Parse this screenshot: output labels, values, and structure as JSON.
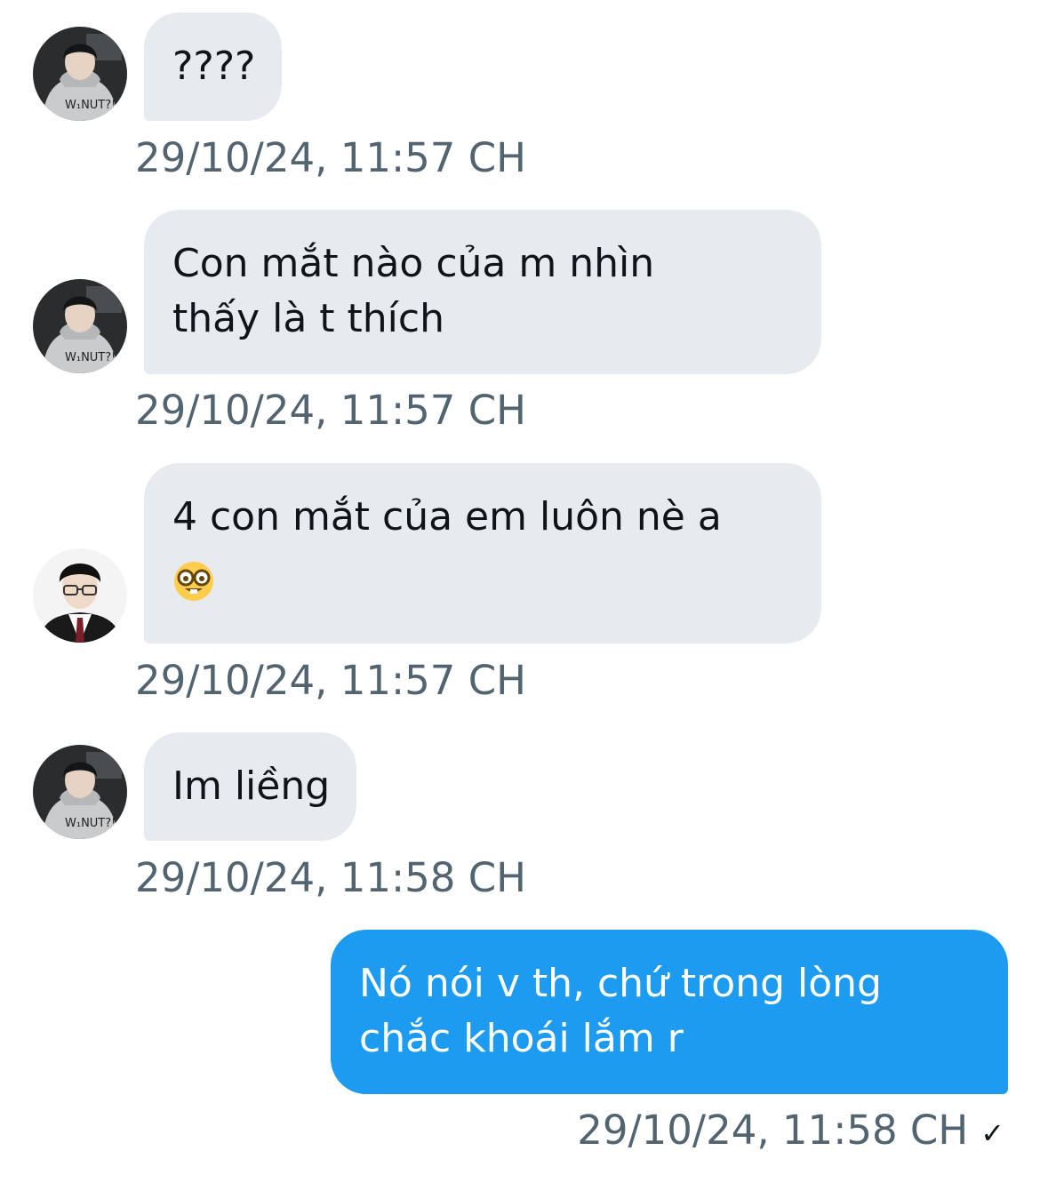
{
  "messages": [
    {
      "sender": "other",
      "avatar": "avatar-hoodie",
      "lines": [
        "????"
      ],
      "timestamp": "29/10/24, 11:57 CH"
    },
    {
      "sender": "other",
      "avatar": "avatar-hoodie",
      "lines": [
        "Con mắt nào của m nhìn",
        "thấy là t thích"
      ],
      "timestamp": "29/10/24, 11:57 CH"
    },
    {
      "sender": "other",
      "avatar": "avatar-glasses",
      "lines": [
        "4 con mắt của em luôn nè a"
      ],
      "emoji": "nerd-face-emoji",
      "timestamp": "29/10/24, 11:57 CH"
    },
    {
      "sender": "other",
      "avatar": "avatar-hoodie",
      "lines": [
        "Im liềng"
      ],
      "timestamp": "29/10/24, 11:58 CH"
    },
    {
      "sender": "self",
      "lines": [
        "Nó nói v th, chứ trong lòng",
        "chắc khoái lắm r"
      ],
      "timestamp": "29/10/24, 11:58 CH",
      "status_icon": "checkmark-icon",
      "status_glyph": "✓"
    }
  ],
  "colors": {
    "incoming_bubble": "#e7ebef",
    "outgoing_bubble": "#1d9bf0",
    "timestamp": "#536471"
  }
}
